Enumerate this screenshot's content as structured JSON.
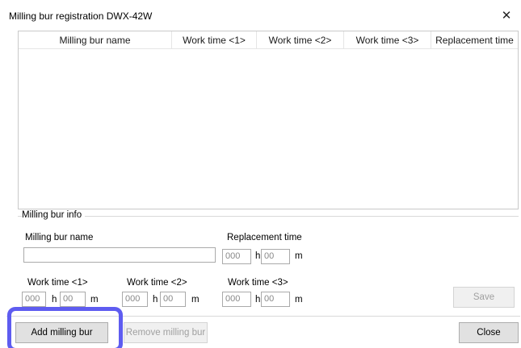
{
  "window": {
    "title": "Milling bur registration DWX-42W",
    "close_glyph": "✕"
  },
  "list": {
    "columns": [
      "Milling bur name",
      "Work time <1>",
      "Work time <2>",
      "Work time <3>",
      "Replacement time"
    ],
    "rows": []
  },
  "info": {
    "group_label": "Milling bur info",
    "name_label": "Milling bur name",
    "name_value": "",
    "replacement_label": "Replacement time",
    "replacement_hours": "000",
    "replacement_minutes": "00",
    "work1_label": "Work time <1>",
    "work1_hours": "000",
    "work1_minutes": "00",
    "work2_label": "Work time <2>",
    "work2_hours": "000",
    "work2_minutes": "00",
    "work3_label": "Work time <3>",
    "work3_hours": "000",
    "work3_minutes": "00",
    "hour_unit": "h",
    "minute_unit": "m"
  },
  "buttons": {
    "save": "Save",
    "add": "Add milling bur",
    "remove": "Remove milling bur",
    "close": "Close"
  },
  "colors": {
    "highlight": "#5e5cf0"
  }
}
